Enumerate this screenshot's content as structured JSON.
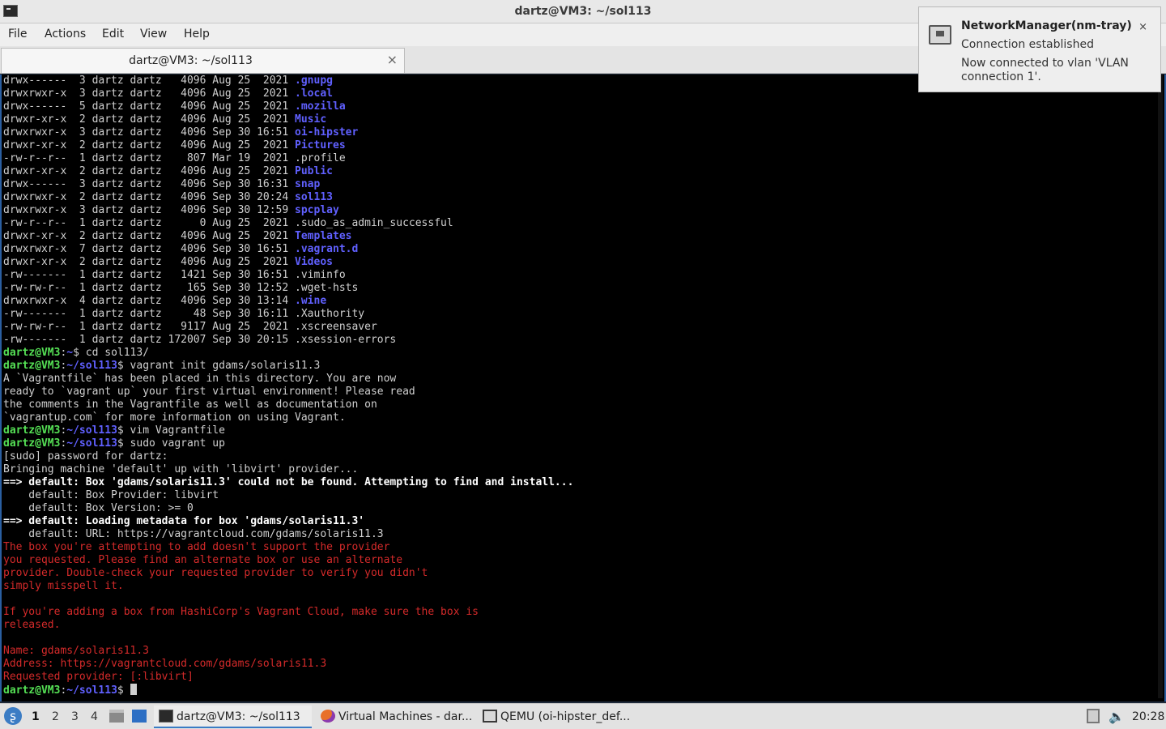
{
  "window": {
    "title": "dartz@VM3: ~/sol113"
  },
  "menu": [
    "File",
    "Actions",
    "Edit",
    "View",
    "Help"
  ],
  "tab": {
    "label": "dartz@VM3: ~/sol113",
    "close": "×"
  },
  "terminal": {
    "lines": [
      [
        {
          "t": "drwx------  3 dartz dartz   4096 Aug 25  2021 "
        },
        {
          "t": ".gnupg",
          "c": "dir"
        }
      ],
      [
        {
          "t": "drwxrwxr-x  3 dartz dartz   4096 Aug 25  2021 "
        },
        {
          "t": ".local",
          "c": "dir"
        }
      ],
      [
        {
          "t": "drwx------  5 dartz dartz   4096 Aug 25  2021 "
        },
        {
          "t": ".mozilla",
          "c": "dir"
        }
      ],
      [
        {
          "t": "drwxr-xr-x  2 dartz dartz   4096 Aug 25  2021 "
        },
        {
          "t": "Music",
          "c": "dir"
        }
      ],
      [
        {
          "t": "drwxrwxr-x  3 dartz dartz   4096 Sep 30 16:51 "
        },
        {
          "t": "oi-hipster",
          "c": "dir"
        }
      ],
      [
        {
          "t": "drwxr-xr-x  2 dartz dartz   4096 Aug 25  2021 "
        },
        {
          "t": "Pictures",
          "c": "dir"
        }
      ],
      [
        {
          "t": "-rw-r--r--  1 dartz dartz    807 Mar 19  2021 .profile"
        }
      ],
      [
        {
          "t": "drwxr-xr-x  2 dartz dartz   4096 Aug 25  2021 "
        },
        {
          "t": "Public",
          "c": "dir"
        }
      ],
      [
        {
          "t": "drwx------  3 dartz dartz   4096 Sep 30 16:31 "
        },
        {
          "t": "snap",
          "c": "dir"
        }
      ],
      [
        {
          "t": "drwxrwxr-x  2 dartz dartz   4096 Sep 30 20:24 "
        },
        {
          "t": "sol113",
          "c": "dir"
        }
      ],
      [
        {
          "t": "drwxrwxr-x  3 dartz dartz   4096 Sep 30 12:59 "
        },
        {
          "t": "spcplay",
          "c": "dir"
        }
      ],
      [
        {
          "t": "-rw-r--r--  1 dartz dartz      0 Aug 25  2021 .sudo_as_admin_successful"
        }
      ],
      [
        {
          "t": "drwxr-xr-x  2 dartz dartz   4096 Aug 25  2021 "
        },
        {
          "t": "Templates",
          "c": "dir"
        }
      ],
      [
        {
          "t": "drwxrwxr-x  7 dartz dartz   4096 Sep 30 16:51 "
        },
        {
          "t": ".vagrant.d",
          "c": "dir"
        }
      ],
      [
        {
          "t": "drwxr-xr-x  2 dartz dartz   4096 Aug 25  2021 "
        },
        {
          "t": "Videos",
          "c": "dir"
        }
      ],
      [
        {
          "t": "-rw-------  1 dartz dartz   1421 Sep 30 16:51 .viminfo"
        }
      ],
      [
        {
          "t": "-rw-rw-r--  1 dartz dartz    165 Sep 30 12:52 .wget-hsts"
        }
      ],
      [
        {
          "t": "drwxrwxr-x  4 dartz dartz   4096 Sep 30 13:14 "
        },
        {
          "t": ".wine",
          "c": "dir"
        }
      ],
      [
        {
          "t": "-rw-------  1 dartz dartz     48 Sep 30 16:11 .Xauthority"
        }
      ],
      [
        {
          "t": "-rw-rw-r--  1 dartz dartz   9117 Aug 25  2021 .xscreensaver"
        }
      ],
      [
        {
          "t": "-rw-------  1 dartz dartz 172007 Sep 30 20:15 .xsession-errors"
        }
      ],
      [
        {
          "t": "dartz@VM3",
          "c": "prompt"
        },
        {
          "t": ":"
        },
        {
          "t": "~",
          "c": "path"
        },
        {
          "t": "$ cd sol113/"
        }
      ],
      [
        {
          "t": "dartz@VM3",
          "c": "prompt"
        },
        {
          "t": ":"
        },
        {
          "t": "~/sol113",
          "c": "path"
        },
        {
          "t": "$ vagrant init gdams/solaris11.3"
        }
      ],
      [
        {
          "t": "A `Vagrantfile` has been placed in this directory. You are now"
        }
      ],
      [
        {
          "t": "ready to `vagrant up` your first virtual environment! Please read"
        }
      ],
      [
        {
          "t": "the comments in the Vagrantfile as well as documentation on"
        }
      ],
      [
        {
          "t": "`vagrantup.com` for more information on using Vagrant."
        }
      ],
      [
        {
          "t": "dartz@VM3",
          "c": "prompt"
        },
        {
          "t": ":"
        },
        {
          "t": "~/sol113",
          "c": "path"
        },
        {
          "t": "$ vim Vagrantfile"
        }
      ],
      [
        {
          "t": "dartz@VM3",
          "c": "prompt"
        },
        {
          "t": ":"
        },
        {
          "t": "~/sol113",
          "c": "path"
        },
        {
          "t": "$ sudo vagrant up"
        }
      ],
      [
        {
          "t": "[sudo] password for dartz:"
        }
      ],
      [
        {
          "t": "Bringing machine 'default' up with 'libvirt' provider..."
        }
      ],
      [
        {
          "t": "==> default: Box 'gdams/solaris11.3' could not be found. Attempting to find and install...",
          "c": "bold"
        }
      ],
      [
        {
          "t": "    default: Box Provider: libvirt"
        }
      ],
      [
        {
          "t": "    default: Box Version: >= 0"
        }
      ],
      [
        {
          "t": "==> default: Loading metadata for box 'gdams/solaris11.3'",
          "c": "bold"
        }
      ],
      [
        {
          "t": "    default: URL: https://vagrantcloud.com/gdams/solaris11.3"
        }
      ],
      [
        {
          "t": "The box you're attempting to add doesn't support the provider",
          "c": "err"
        }
      ],
      [
        {
          "t": "you requested. Please find an alternate box or use an alternate",
          "c": "err"
        }
      ],
      [
        {
          "t": "provider. Double-check your requested provider to verify you didn't",
          "c": "err"
        }
      ],
      [
        {
          "t": "simply misspell it.",
          "c": "err"
        }
      ],
      [
        {
          "t": ""
        }
      ],
      [
        {
          "t": "If you're adding a box from HashiCorp's Vagrant Cloud, make sure the box is",
          "c": "err"
        }
      ],
      [
        {
          "t": "released.",
          "c": "err"
        }
      ],
      [
        {
          "t": ""
        }
      ],
      [
        {
          "t": "Name: gdams/solaris11.3",
          "c": "err"
        }
      ],
      [
        {
          "t": "Address: https://vagrantcloud.com/gdams/solaris11.3",
          "c": "err"
        }
      ],
      [
        {
          "t": "Requested provider: [:libvirt]",
          "c": "err"
        }
      ],
      [
        {
          "t": "dartz@VM3",
          "c": "prompt"
        },
        {
          "t": ":"
        },
        {
          "t": "~/sol113",
          "c": "path"
        },
        {
          "t": "$ "
        }
      ]
    ]
  },
  "notification": {
    "title": "NetworkManager(nm-tray)",
    "body1": "Connection established",
    "body2": "Now connected to vlan 'VLAN connection 1'.",
    "close": "×"
  },
  "taskbar": {
    "start_glyph": "ʂ",
    "desktops": [
      "1",
      "2",
      "3",
      "4"
    ],
    "tasks": [
      {
        "label": "dartz@VM3: ~/sol113",
        "icon": "terminal-icon"
      },
      {
        "label": "Virtual Machines - dar...",
        "icon": "firefox-icon"
      },
      {
        "label": "QEMU (oi-hipster_def...",
        "icon": "qemu-icon"
      }
    ],
    "volume_glyph": "🔈",
    "clock": "20:28"
  },
  "colors": {
    "terminal_bg": "#000000",
    "dir": "#6060ff",
    "prompt": "#55e055",
    "error": "#d42a2a",
    "accent": "#3b7cc4"
  }
}
